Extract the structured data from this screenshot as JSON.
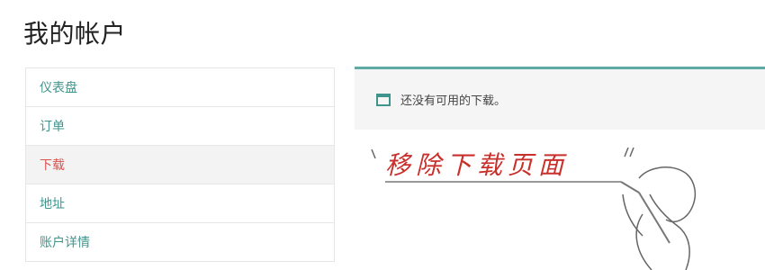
{
  "page": {
    "title": "我的帐户"
  },
  "sidebar": {
    "items": [
      {
        "label": "仪表盘",
        "active": false
      },
      {
        "label": "订单",
        "active": false
      },
      {
        "label": "下载",
        "active": true
      },
      {
        "label": "地址",
        "active": false
      },
      {
        "label": "账户详情",
        "active": false
      }
    ]
  },
  "notice": {
    "text": "还没有可用的下载。",
    "icon": "square-icon"
  },
  "illustration": {
    "text": "移除下载页面",
    "icon": "hand-pen-icon"
  },
  "colors": {
    "accent": "#3f958c",
    "active": "#d9534f",
    "notice_border": "#5faaa5",
    "illustration_text": "#c9302c"
  }
}
